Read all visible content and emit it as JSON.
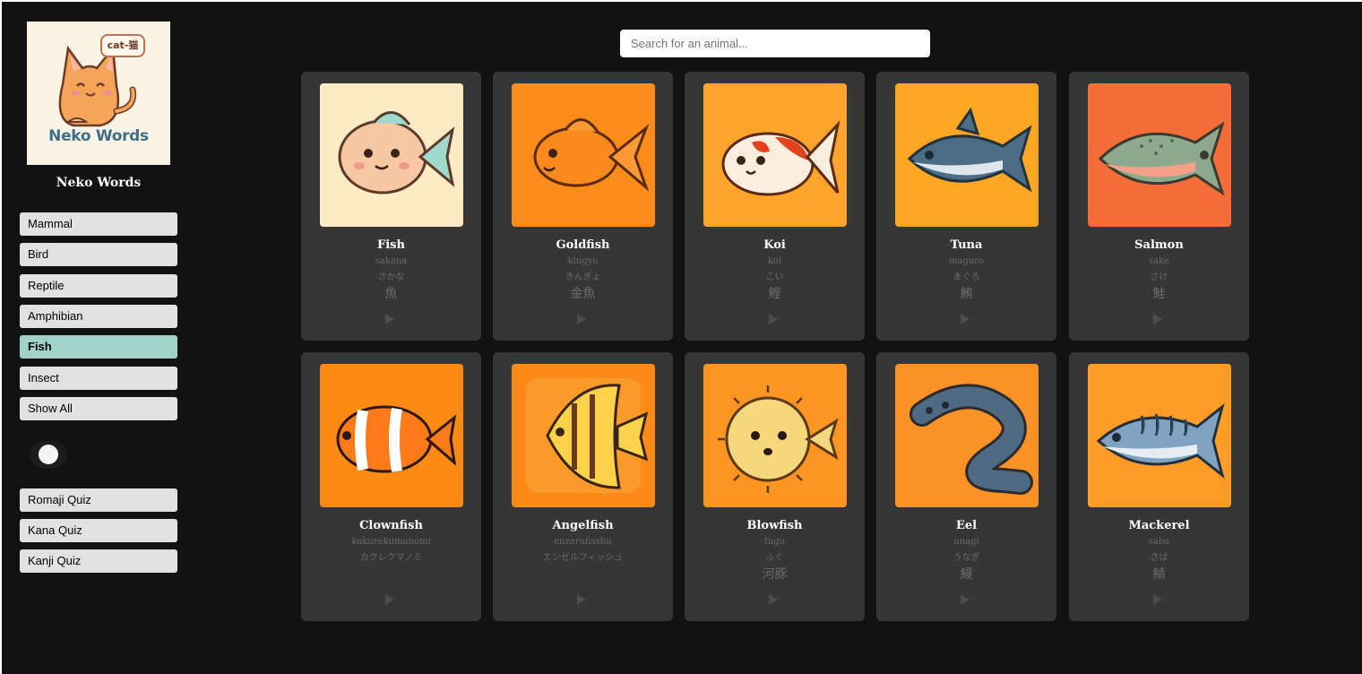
{
  "sidebar": {
    "logo": {
      "badge": "cat-猫",
      "text": "Neko Words"
    },
    "title": "Neko Words",
    "categories": [
      {
        "label": "Mammal",
        "active": false
      },
      {
        "label": "Bird",
        "active": false
      },
      {
        "label": "Reptile",
        "active": false
      },
      {
        "label": "Amphibian",
        "active": false
      },
      {
        "label": "Fish",
        "active": true
      },
      {
        "label": "Insect",
        "active": false
      },
      {
        "label": "Show All",
        "active": false
      }
    ],
    "toggle": {
      "state": "off"
    },
    "quizzes": [
      {
        "label": "Romaji Quiz"
      },
      {
        "label": "Kana Quiz"
      },
      {
        "label": "Kanji Quiz"
      }
    ]
  },
  "search": {
    "placeholder": "Search for an animal...",
    "value": ""
  },
  "cards": [
    {
      "name": "Fish",
      "romaji": "sakana",
      "kana": "さかな",
      "kanji": "魚",
      "bg": "#fdebc6",
      "icon": "fish-icon"
    },
    {
      "name": "Goldfish",
      "romaji": "kingyo",
      "kana": "きんぎょ",
      "kanji": "金魚",
      "bg": "#fb8c19",
      "icon": "goldfish-icon"
    },
    {
      "name": "Koi",
      "romaji": "koi",
      "kana": "こい",
      "kanji": "鯉",
      "bg": "#fca52a",
      "icon": "koi-icon"
    },
    {
      "name": "Tuna",
      "romaji": "maguro",
      "kana": "まぐろ",
      "kanji": "鮪",
      "bg": "#fda722",
      "icon": "tuna-icon"
    },
    {
      "name": "Salmon",
      "romaji": "sake",
      "kana": "さけ",
      "kanji": "鮭",
      "bg": "#f46d38",
      "icon": "salmon-icon"
    },
    {
      "name": "Clownfish",
      "romaji": "kakurekumanomi",
      "kana": "カクレクマノミ",
      "kanji": "",
      "bg": "#fd8a14",
      "icon": "clownfish-icon"
    },
    {
      "name": "Angelfish",
      "romaji": "enzerufisshu",
      "kana": "エンゼルフィッシュ",
      "kanji": "",
      "bg": "#fb8a16",
      "icon": "angelfish-icon"
    },
    {
      "name": "Blowfish",
      "romaji": "fugu",
      "kana": "ふぐ",
      "kanji": "河豚",
      "bg": "#fd9522",
      "icon": "blowfish-icon"
    },
    {
      "name": "Eel",
      "romaji": "unagi",
      "kana": "うなぎ",
      "kanji": "鰻",
      "bg": "#fb9227",
      "icon": "eel-icon"
    },
    {
      "name": "Mackerel",
      "romaji": "saba",
      "kana": "さば",
      "kanji": "鯖",
      "bg": "#fd9c27",
      "icon": "mackerel-icon"
    }
  ]
}
